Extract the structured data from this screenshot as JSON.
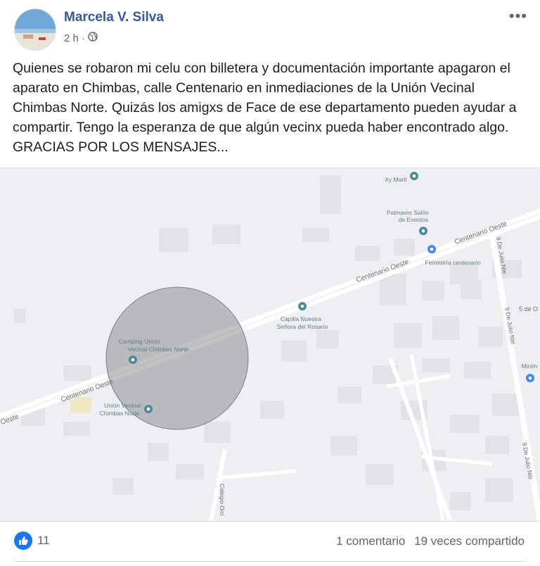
{
  "post": {
    "author": "Marcela V. Silva",
    "time": "2 h",
    "separator": "·",
    "text": "Quienes se robaron mi celu con billetera y documentación importante apagaron el aparato en Chimbas, calle Centenario en inmediaciones de la Unión Vecinal Chimbas Norte. Quizás los amigxs de Face de ese departamento pueden ayudar a compartir. Tengo la esperanza de que algún vecinx pueda haber encontrado algo. GRACIAS POR LOS MENSAJES...",
    "more_icon": "ellipsis-icon",
    "privacy_icon": "globe-icon"
  },
  "map": {
    "labels": {
      "xy_marti": "Xy Martí",
      "palmares_1": "Palmares Salón",
      "palmares_2": "de Eventos",
      "ferreteria": "Ferretería centenario",
      "capilla_1": "Capilla Nuestra",
      "capilla_2": "Señora del Rosario",
      "camping_1": "Camping Unión",
      "camping_2": "Vecinal Chimbas Norte",
      "union_1": "Unión Vecinal",
      "union_2": "Chimbas Norte",
      "street_centenario_e1": "Centenario Oeste",
      "street_centenario_e2": "Centenario Oeste",
      "street_centenario_w1": "Centenario Oeste",
      "street_oeste": "Oeste",
      "julio_1": "9 De Julio Nte",
      "julio_2": "9 De Julio Nte",
      "julio_3": "9 De Julio Nte",
      "cinco_de": "5 de O",
      "colegio": "Colegio Orri",
      "minim": "Minim"
    },
    "colors": {
      "background": "#eeeff2",
      "road": "#ffffff",
      "pin": "#4e8a97",
      "blue_pin": "#4285f4",
      "circle": "#8d8e91"
    }
  },
  "footer": {
    "like_count": "11",
    "comments": "1 comentario",
    "shares": "19 veces compartido",
    "like_icon": "thumbs-up-icon"
  }
}
